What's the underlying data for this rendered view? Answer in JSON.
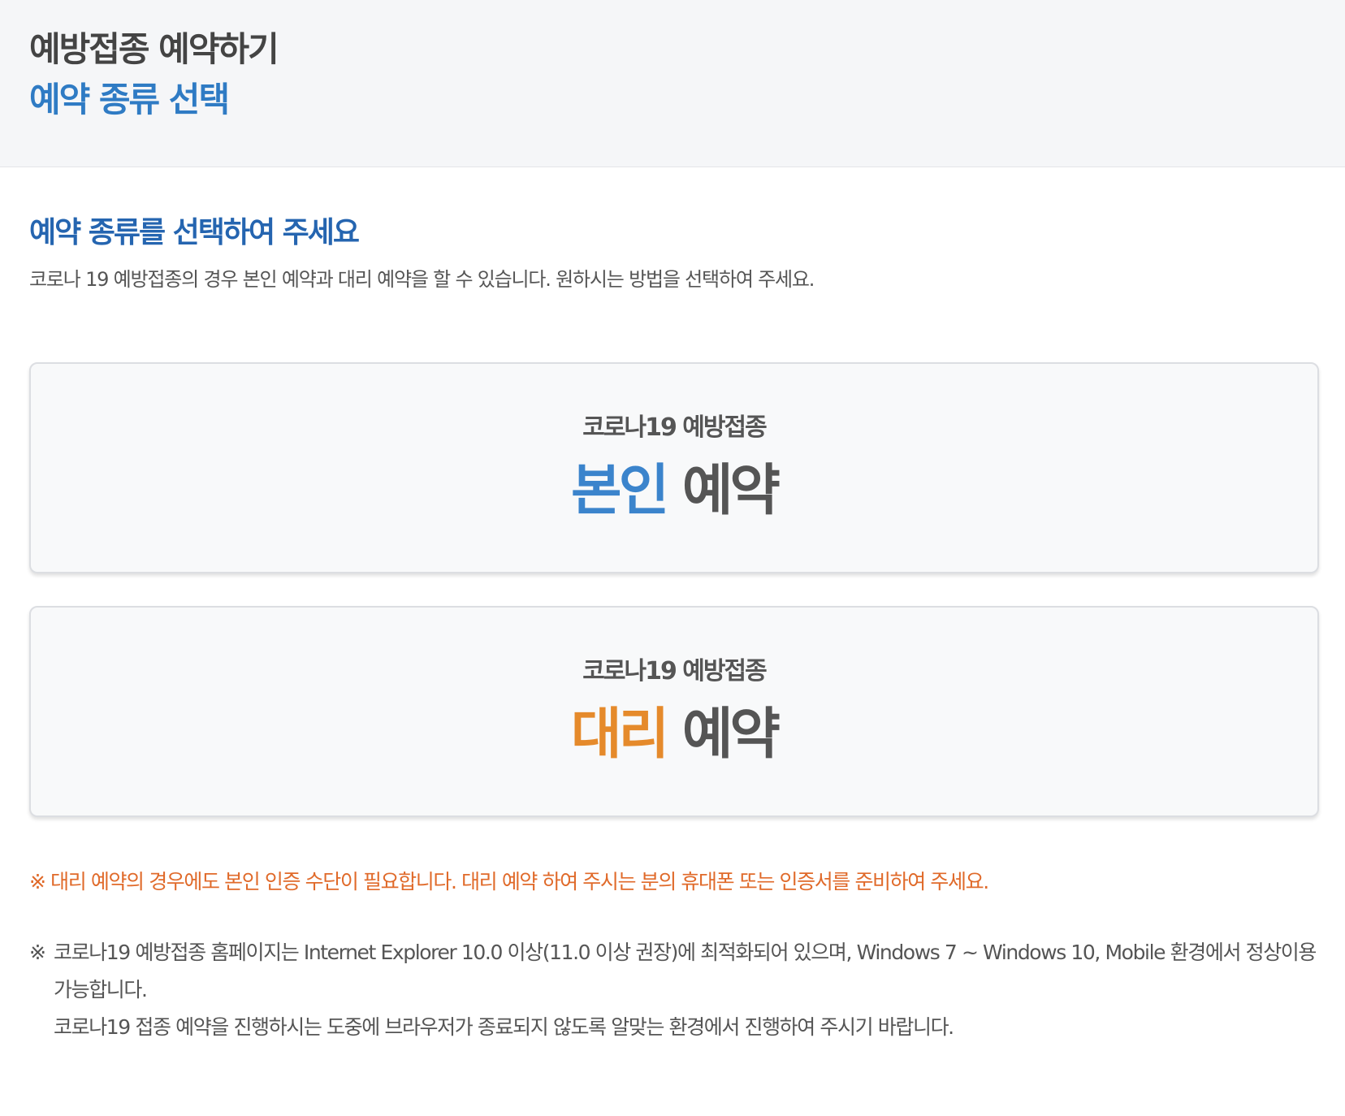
{
  "header": {
    "title": "예방접종 예약하기",
    "subtitle": "예약 종류 선택"
  },
  "main": {
    "heading": "예약 종류를 선택하여 주세요",
    "description": "코로나 19 예방접종의 경우 본인 예약과 대리 예약을 할 수 있습니다. 원하시는 방법을 선택하여 주세요.",
    "options": [
      {
        "sub_label": "코로나19 예방접종",
        "accent_label": "본인",
        "main_label": "예약",
        "accent_color": "#3b84cc"
      },
      {
        "sub_label": "코로나19 예방접종",
        "accent_label": "대리",
        "main_label": "예약",
        "accent_color": "#e58a2b"
      }
    ],
    "warning": "※ 대리 예약의 경우에도 본인 인증 수단이 필요합니다. 대리 예약 하여 주시는 분의 휴대폰 또는 인증서를 준비하여 주세요.",
    "info_mark": "※",
    "info_line1": "코로나19 예방접종 홈페이지는 Internet Explorer 10.0 이상(11.0 이상 권장)에 최적화되어 있으며, Windows 7 ~ Windows 10, Mobile 환경에서 정상이용 가능합니다.",
    "info_line2": "코로나19 접종 예약을 진행하시는 도중에 브라우저가 종료되지 않도록 알맞는 환경에서 진행하여 주시기 바랍니다."
  },
  "colors": {
    "heading_blue": "#2565b0",
    "subtitle_blue": "#2f7bc4",
    "warning_orange": "#e06a2a"
  }
}
